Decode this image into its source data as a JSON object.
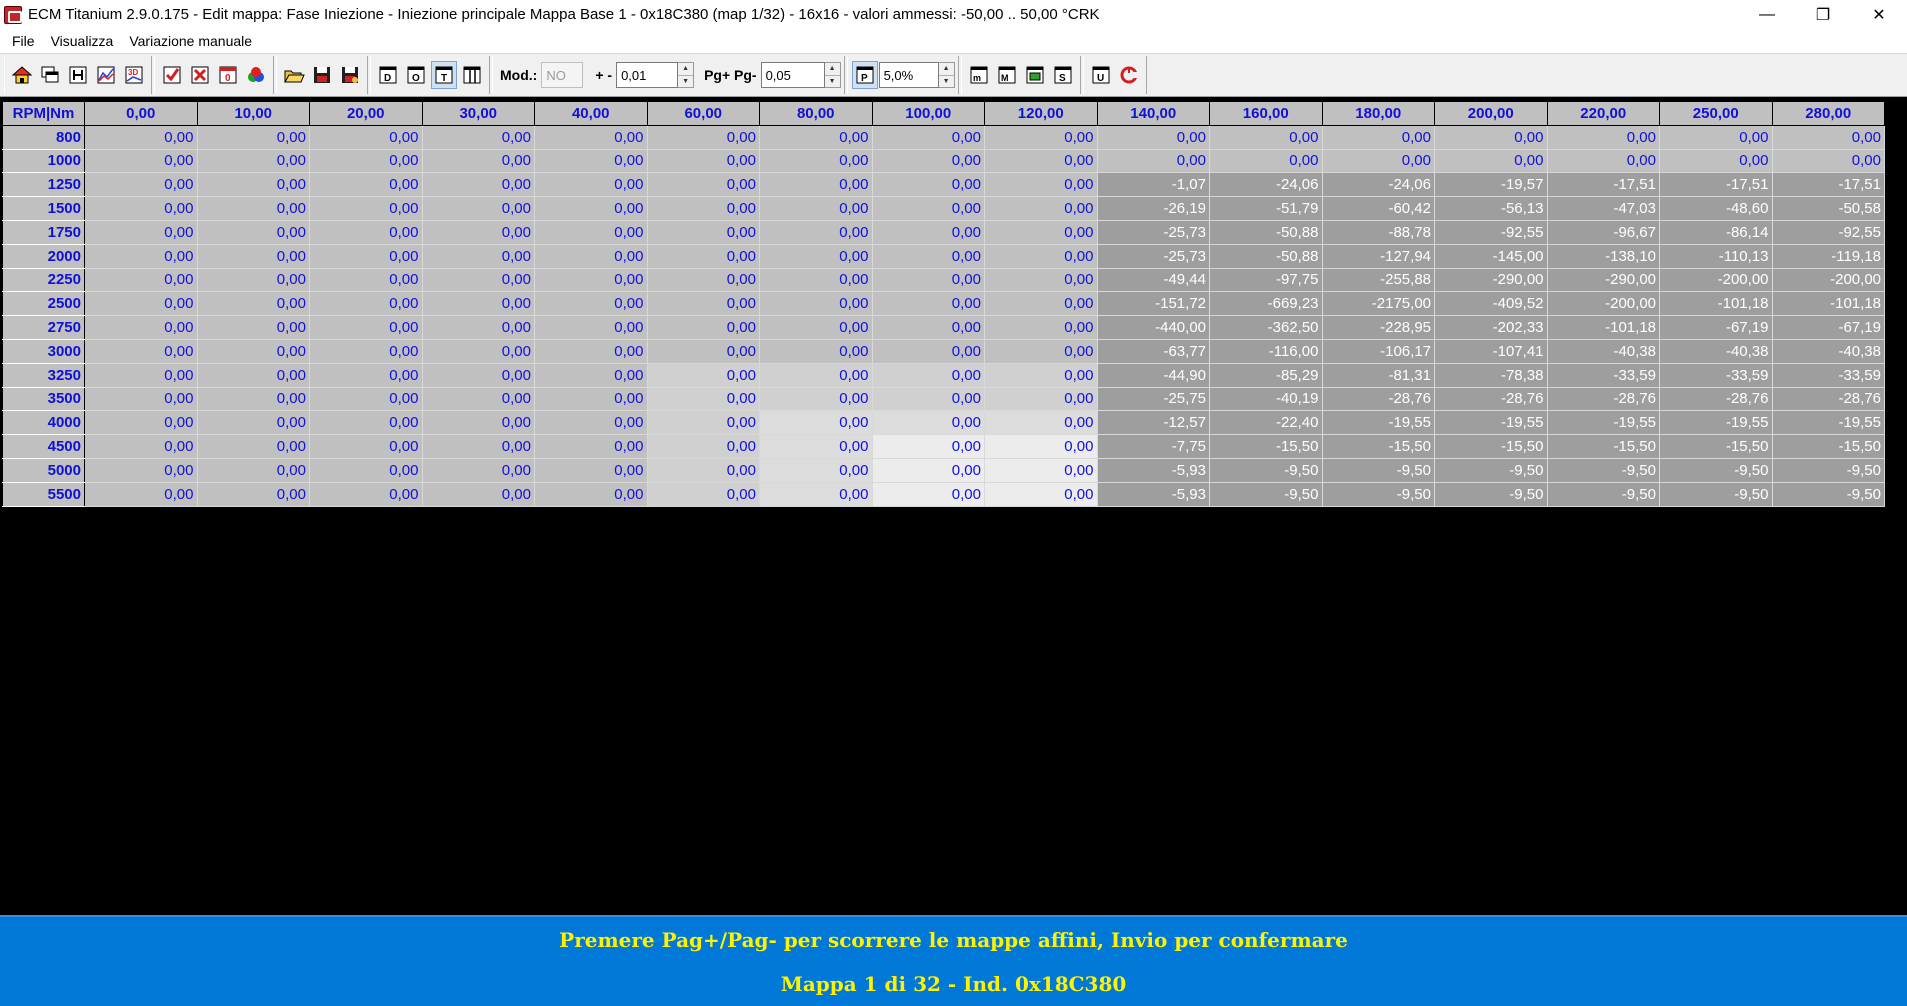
{
  "window": {
    "title": "ECM Titanium 2.9.0.175 - Edit mappa: Fase Iniezione - Iniezione principale Mappa Base 1 - 0x18C380 (map 1/32) - 16x16 - valori ammessi: -50,00 .. 50,00 °CRK",
    "minimize": "—",
    "restore": "❐",
    "close": "✕"
  },
  "menu": [
    "File",
    "Visualizza",
    "Variazione manuale"
  ],
  "toolbar": {
    "mod_label": "Mod.:",
    "mod_value": "NO",
    "step_label": "+ -",
    "step_value": "0,01",
    "page_label": "Pg+ Pg-",
    "page_value": "0,05",
    "percent_value": "5,0%"
  },
  "colors": {
    "bg_light": "#c0c0c0",
    "bg_dark": "#9e9e9e",
    "text_blue": "#1010e0",
    "text_white": "#ffffff",
    "status_bg": "#0078d7",
    "status_text": "#fff200"
  },
  "grid": {
    "corner": "RPM|Nm",
    "columns": [
      "0,00",
      "10,00",
      "20,00",
      "30,00",
      "40,00",
      "60,00",
      "80,00",
      "100,00",
      "120,00",
      "140,00",
      "160,00",
      "180,00",
      "200,00",
      "220,00",
      "250,00",
      "280,00"
    ],
    "rows": [
      {
        "rpm": "800",
        "values": [
          "0,00",
          "0,00",
          "0,00",
          "0,00",
          "0,00",
          "0,00",
          "0,00",
          "0,00",
          "0,00",
          "0,00",
          "0,00",
          "0,00",
          "0,00",
          "0,00",
          "0,00",
          "0,00"
        ]
      },
      {
        "rpm": "1000",
        "values": [
          "0,00",
          "0,00",
          "0,00",
          "0,00",
          "0,00",
          "0,00",
          "0,00",
          "0,00",
          "0,00",
          "0,00",
          "0,00",
          "0,00",
          "0,00",
          "0,00",
          "0,00",
          "0,00"
        ]
      },
      {
        "rpm": "1250",
        "values": [
          "0,00",
          "0,00",
          "0,00",
          "0,00",
          "0,00",
          "0,00",
          "0,00",
          "0,00",
          "0,00",
          "-1,07",
          "-24,06",
          "-24,06",
          "-19,57",
          "-17,51",
          "-17,51",
          "-17,51"
        ]
      },
      {
        "rpm": "1500",
        "values": [
          "0,00",
          "0,00",
          "0,00",
          "0,00",
          "0,00",
          "0,00",
          "0,00",
          "0,00",
          "0,00",
          "-26,19",
          "-51,79",
          "-60,42",
          "-56,13",
          "-47,03",
          "-48,60",
          "-50,58"
        ]
      },
      {
        "rpm": "1750",
        "values": [
          "0,00",
          "0,00",
          "0,00",
          "0,00",
          "0,00",
          "0,00",
          "0,00",
          "0,00",
          "0,00",
          "-25,73",
          "-50,88",
          "-88,78",
          "-92,55",
          "-96,67",
          "-86,14",
          "-92,55"
        ]
      },
      {
        "rpm": "2000",
        "values": [
          "0,00",
          "0,00",
          "0,00",
          "0,00",
          "0,00",
          "0,00",
          "0,00",
          "0,00",
          "0,00",
          "-25,73",
          "-50,88",
          "-127,94",
          "-145,00",
          "-138,10",
          "-110,13",
          "-119,18"
        ]
      },
      {
        "rpm": "2250",
        "values": [
          "0,00",
          "0,00",
          "0,00",
          "0,00",
          "0,00",
          "0,00",
          "0,00",
          "0,00",
          "0,00",
          "-49,44",
          "-97,75",
          "-255,88",
          "-290,00",
          "-290,00",
          "-200,00",
          "-200,00"
        ]
      },
      {
        "rpm": "2500",
        "values": [
          "0,00",
          "0,00",
          "0,00",
          "0,00",
          "0,00",
          "0,00",
          "0,00",
          "0,00",
          "0,00",
          "-151,72",
          "-669,23",
          "-2175,00",
          "-409,52",
          "-200,00",
          "-101,18",
          "-101,18"
        ]
      },
      {
        "rpm": "2750",
        "values": [
          "0,00",
          "0,00",
          "0,00",
          "0,00",
          "0,00",
          "0,00",
          "0,00",
          "0,00",
          "0,00",
          "-440,00",
          "-362,50",
          "-228,95",
          "-202,33",
          "-101,18",
          "-67,19",
          "-67,19"
        ]
      },
      {
        "rpm": "3000",
        "values": [
          "0,00",
          "0,00",
          "0,00",
          "0,00",
          "0,00",
          "0,00",
          "0,00",
          "0,00",
          "0,00",
          "-63,77",
          "-116,00",
          "-106,17",
          "-107,41",
          "-40,38",
          "-40,38",
          "-40,38"
        ]
      },
      {
        "rpm": "3250",
        "values": [
          "0,00",
          "0,00",
          "0,00",
          "0,00",
          "0,00",
          "0,00",
          "0,00",
          "0,00",
          "0,00",
          "-44,90",
          "-85,29",
          "-81,31",
          "-78,38",
          "-33,59",
          "-33,59",
          "-33,59"
        ]
      },
      {
        "rpm": "3500",
        "values": [
          "0,00",
          "0,00",
          "0,00",
          "0,00",
          "0,00",
          "0,00",
          "0,00",
          "0,00",
          "0,00",
          "-25,75",
          "-40,19",
          "-28,76",
          "-28,76",
          "-28,76",
          "-28,76",
          "-28,76"
        ]
      },
      {
        "rpm": "4000",
        "values": [
          "0,00",
          "0,00",
          "0,00",
          "0,00",
          "0,00",
          "0,00",
          "0,00",
          "0,00",
          "0,00",
          "-12,57",
          "-22,40",
          "-19,55",
          "-19,55",
          "-19,55",
          "-19,55",
          "-19,55"
        ]
      },
      {
        "rpm": "4500",
        "values": [
          "0,00",
          "0,00",
          "0,00",
          "0,00",
          "0,00",
          "0,00",
          "0,00",
          "0,00",
          "0,00",
          "-7,75",
          "-15,50",
          "-15,50",
          "-15,50",
          "-15,50",
          "-15,50",
          "-15,50"
        ]
      },
      {
        "rpm": "5000",
        "values": [
          "0,00",
          "0,00",
          "0,00",
          "0,00",
          "0,00",
          "0,00",
          "0,00",
          "0,00",
          "0,00",
          "-5,93",
          "-9,50",
          "-9,50",
          "-9,50",
          "-9,50",
          "-9,50",
          "-9,50"
        ]
      },
      {
        "rpm": "5500",
        "values": [
          "0,00",
          "0,00",
          "0,00",
          "0,00",
          "0,00",
          "0,00",
          "0,00",
          "0,00",
          "0,00",
          "-5,93",
          "-9,50",
          "-9,50",
          "-9,50",
          "-9,50",
          "-9,50",
          "-9,50"
        ]
      }
    ]
  },
  "status": {
    "line1": "Premere Pag+/Pag- per scorrere le mappe affini, Invio per confermare",
    "line2": "Mappa 1 di 32 - Ind. 0x18C380"
  }
}
